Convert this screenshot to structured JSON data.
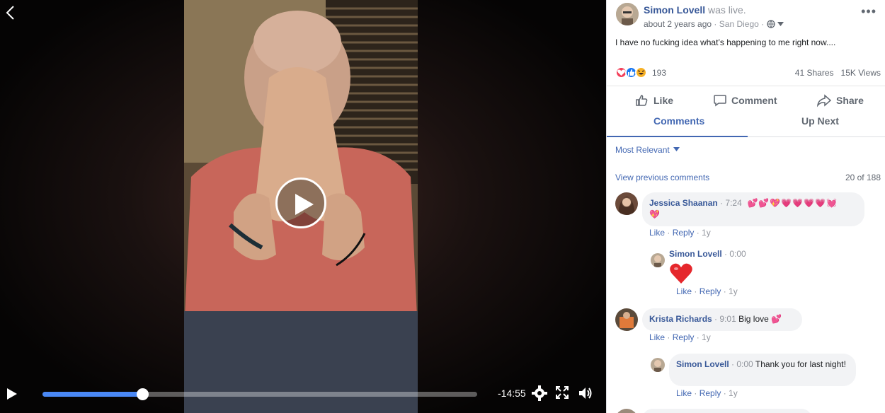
{
  "video": {
    "time_remaining": "-14:55",
    "progress_fraction": 0.23
  },
  "post": {
    "author": "Simon Lovell",
    "status": "was live.",
    "time": "about 2 years ago",
    "location": "San Diego",
    "text": "I have no fucking idea what’s happening to me right now....",
    "reaction_count": "193",
    "shares": "41 Shares",
    "views": "15K Views",
    "more_icon": "more-dots-icon"
  },
  "actions": {
    "like": "Like",
    "comment": "Comment",
    "share": "Share"
  },
  "tabs": {
    "comments": "Comments",
    "up_next": "Up Next"
  },
  "comments_section": {
    "sort_label": "Most Relevant",
    "view_previous": "View previous comments",
    "count": "20 of 188"
  },
  "comments": [
    {
      "name": "Jessica Shaanan",
      "time": "7:24",
      "links": {
        "like": "Like",
        "reply": "Reply",
        "age": "1y"
      },
      "reply": {
        "name": "Simon Lovell",
        "time": "0:00",
        "links": {
          "like": "Like",
          "reply": "Reply",
          "age": "1y"
        }
      }
    },
    {
      "name": "Krista Richards",
      "time": "9:01",
      "text": "Big love",
      "links": {
        "like": "Like",
        "reply": "Reply",
        "age": "1y"
      },
      "reply": {
        "name": "Simon Lovell",
        "time": "0:00",
        "text": "Thank you for last night!",
        "links": {
          "like": "Like",
          "reply": "Reply",
          "age": "1y"
        }
      }
    }
  ],
  "colors": {
    "link": "#385898",
    "accent": "#4267b2",
    "progress": "#4a88f5"
  }
}
